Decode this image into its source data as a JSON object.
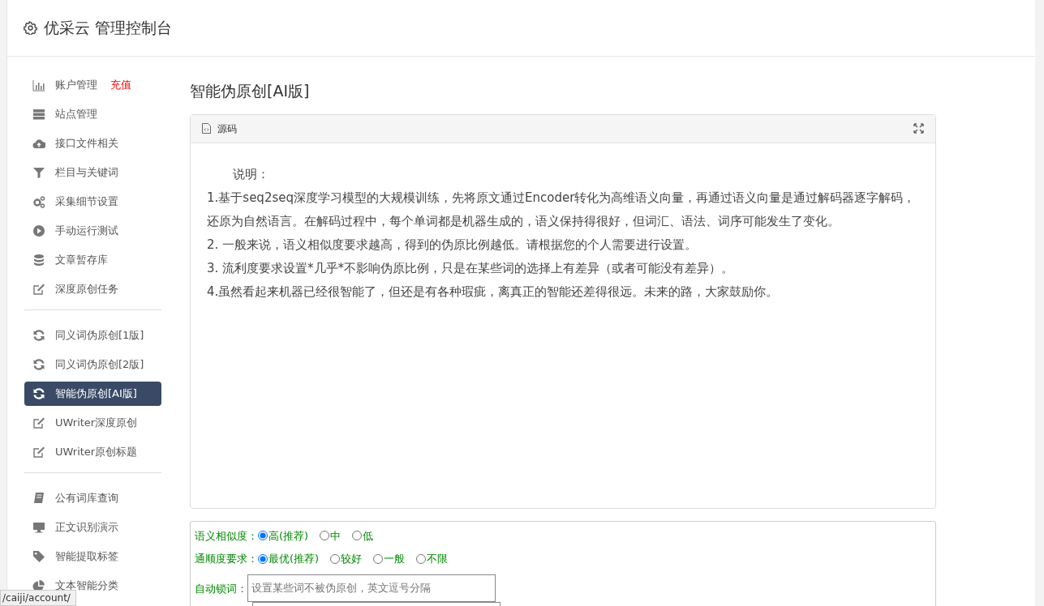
{
  "header": {
    "title": "优采云 管理控制台"
  },
  "sidebar": {
    "groups": [
      {
        "items": [
          {
            "label": "账户管理",
            "badge": "充值",
            "selected": false
          },
          {
            "label": "站点管理",
            "selected": false
          },
          {
            "label": "接口文件相关",
            "selected": false
          },
          {
            "label": "栏目与关键词",
            "selected": false
          },
          {
            "label": "采集细节设置",
            "selected": false
          },
          {
            "label": "手动运行测试",
            "selected": false
          },
          {
            "label": "文章暂存库",
            "selected": false
          },
          {
            "label": "深度原创任务",
            "selected": false
          }
        ]
      },
      {
        "items": [
          {
            "label": "同义词伪原创[1版]",
            "selected": false
          },
          {
            "label": "同义词伪原创[2版]",
            "selected": false
          },
          {
            "label": "智能伪原创[AI版]",
            "selected": true
          },
          {
            "label": "UWriter深度原创",
            "selected": false
          },
          {
            "label": "UWriter原创标题",
            "selected": false
          }
        ]
      },
      {
        "items": [
          {
            "label": "公有词库查询",
            "selected": false
          },
          {
            "label": "正文识别演示",
            "selected": false
          },
          {
            "label": "智能提取标签",
            "selected": false
          },
          {
            "label": "文本智能分类",
            "selected": false
          }
        ]
      }
    ]
  },
  "page_title": "智能伪原创[AI版]",
  "editor": {
    "tab": "源码",
    "lines": [
      "说明：",
      "1.基于seq2seq深度学习模型的大规模训练，先将原文通过Encoder转化为高维语义向量，再通过语义向量是通过解码器逐字解码，还原为自然语言。在解码过程中，每个单词都是机器生成的，语义保持得很好，但词汇、语法、词序可能发生了变化。",
      "2. 一般来说，语义相似度要求越高，得到的伪原比例越低。请根据您的个人需要进行设置。",
      "3. 流利度要求设置*几乎*不影响伪原比例，只是在某些词的选择上有差异（或者可能没有差异）。",
      "4.虽然看起来机器已经很智能了，但还是有各种瑕疵，离真正的智能还差得很远。未来的路，大家鼓励你。"
    ]
  },
  "options": [
    {
      "label": "语义相似度：",
      "choices": [
        {
          "label": "高(推荐)",
          "selected": true
        },
        {
          "label": "中",
          "selected": false
        },
        {
          "label": "低",
          "selected": false
        }
      ]
    },
    {
      "label": "通顺度要求：",
      "choices": [
        {
          "label": "最优(推荐)",
          "selected": true
        },
        {
          "label": "较好",
          "selected": false
        },
        {
          "label": "一般",
          "selected": false
        },
        {
          "label": "不限",
          "selected": false
        }
      ]
    }
  ],
  "lock_words": {
    "label": "自动锁词：",
    "placeholder": "设置某些词不被伪原创，英文逗号分隔"
  },
  "status_bar": {
    "url": "/caiji/account/"
  }
}
